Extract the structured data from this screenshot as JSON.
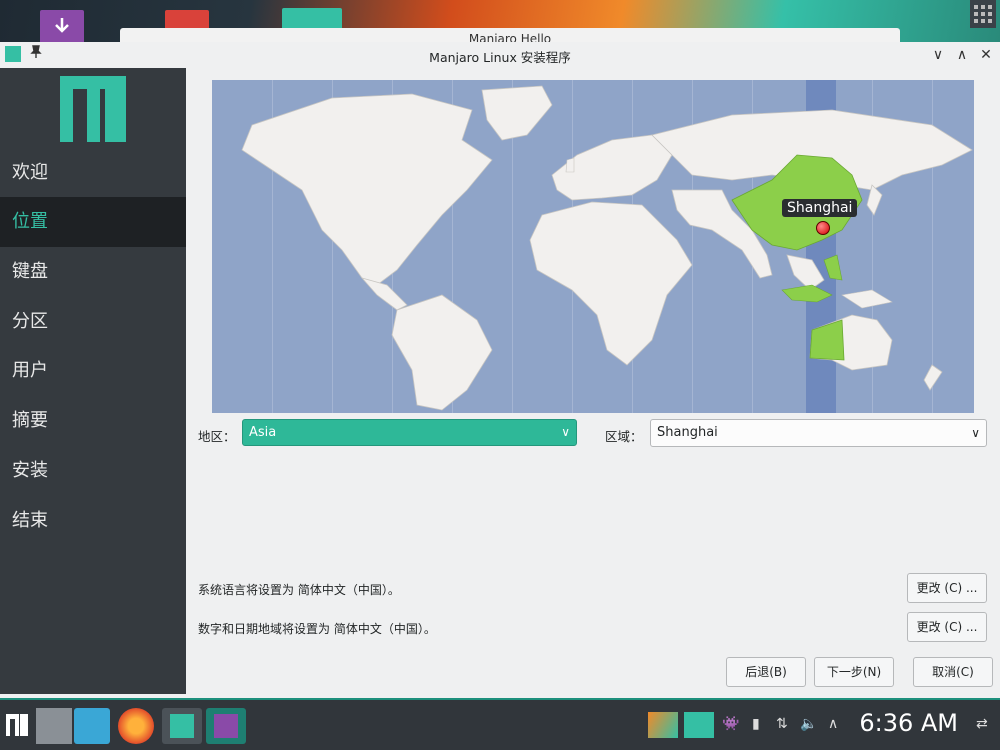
{
  "desktop": {
    "background_window_title": "Manjaro Hello"
  },
  "window": {
    "title": "Manjaro Linux 安装程序",
    "pin_icon": "pin-icon",
    "minimize_glyph": "∨",
    "maximize_glyph": "∧",
    "close_glyph": "✕"
  },
  "sidebar": {
    "items": [
      {
        "label": "欢迎",
        "active": false
      },
      {
        "label": "位置",
        "active": true
      },
      {
        "label": "键盘",
        "active": false
      },
      {
        "label": "分区",
        "active": false
      },
      {
        "label": "用户",
        "active": false
      },
      {
        "label": "摘要",
        "active": false
      },
      {
        "label": "安装",
        "active": false
      },
      {
        "label": "结束",
        "active": false
      }
    ]
  },
  "map": {
    "pin_label": "Shanghai"
  },
  "region": {
    "label": "地区：",
    "value": "Asia"
  },
  "zone": {
    "label": "区域：",
    "value": "Shanghai"
  },
  "info": {
    "language_text": "系统语言将设置为 简体中文（中国）。",
    "locale_text": "数字和日期地域将设置为 简体中文（中国）。",
    "change_button": "更改 (C) ..."
  },
  "nav": {
    "back": "后退(B)",
    "next": "下一步(N)",
    "cancel": "取消(C)"
  },
  "taskbar": {
    "clock": "6:36 AM"
  },
  "colors": {
    "accent": "#35bfa4",
    "sidebar_bg": "#353a3f",
    "timezone_highlight": "#8ccf4a"
  }
}
